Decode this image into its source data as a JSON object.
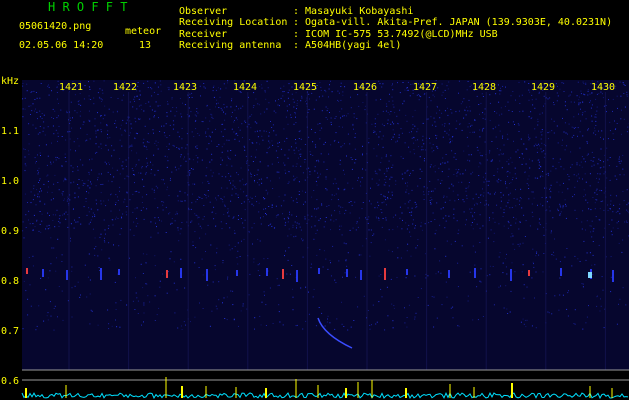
{
  "app": {
    "title": "H R O F F T",
    "filename": "05061420.png",
    "datetime": "02.05.06 14:20",
    "meteor_label": "meteor",
    "meteor_count": "13"
  },
  "info": [
    {
      "label": "Observer",
      "value": ": Masayuki Kobayashi"
    },
    {
      "label": "Receiving Location",
      "value": ": Ogata-vill. Akita-Pref. JAPAN (139.9303E, 40.0231N)"
    },
    {
      "label": "Receiver",
      "value": ": ICOM IC-575 53.7492(@LCD)MHz USB"
    },
    {
      "label": "Receiving antenna",
      "value": ": A504HB(yagi 4el)"
    }
  ],
  "y_axis": {
    "unit": "kHz",
    "ticks": [
      "1.1",
      "1.0",
      "0.9",
      "0.8",
      "0.7",
      "0.6"
    ]
  },
  "x_axis": {
    "ticks": [
      "1421",
      "1422",
      "1423",
      "1424",
      "1425",
      "1426",
      "1427",
      "1428",
      "1429",
      "1430"
    ]
  },
  "colors": {
    "header_text": "#ffff00",
    "axis_text": "#ffff00",
    "background": "#000000",
    "spectrum_base": "#05052a",
    "spectrum_noise": "#2a3cff",
    "meteor_echo": "#ff4040",
    "amplitude_trace": "#00e0ff",
    "amplitude_spike": "#ffff00"
  }
}
